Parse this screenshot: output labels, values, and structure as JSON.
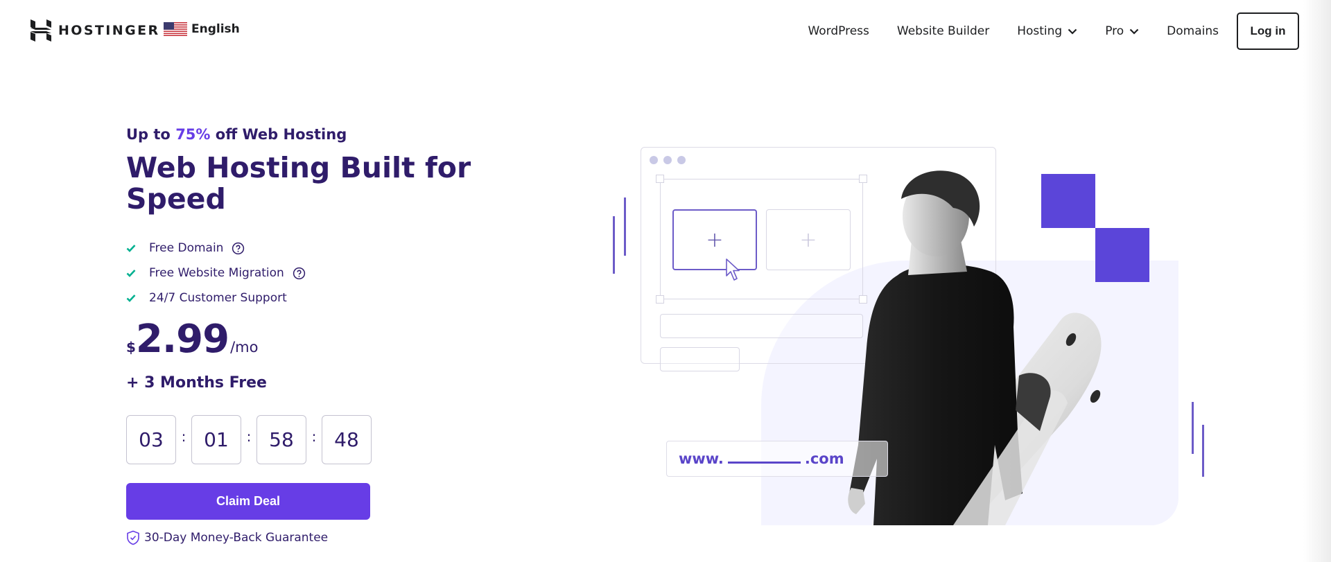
{
  "header": {
    "brand": "HOSTINGER",
    "language": "English",
    "nav": [
      {
        "label": "WordPress",
        "has_dropdown": false
      },
      {
        "label": "Website Builder",
        "has_dropdown": false
      },
      {
        "label": "Hosting",
        "has_dropdown": true
      },
      {
        "label": "Pro",
        "has_dropdown": true
      },
      {
        "label": "Domains",
        "has_dropdown": false
      }
    ],
    "login_label": "Log in"
  },
  "hero": {
    "eyebrow_prefix": "Up to ",
    "eyebrow_accent": "75%",
    "eyebrow_suffix": " off Web Hosting",
    "title": "Web Hosting Built for Speed",
    "features": [
      {
        "label": "Free Domain",
        "has_help": true
      },
      {
        "label": "Free Website Migration",
        "has_help": true
      },
      {
        "label": "24/7 Customer Support",
        "has_help": false
      }
    ],
    "price": {
      "currency": "$",
      "amount": "2.99",
      "period": "/mo"
    },
    "bonus": "+ 3 Months Free",
    "countdown": {
      "days": "03",
      "hours": "01",
      "minutes": "58",
      "seconds": "48",
      "separator": ":"
    },
    "cta_label": "Claim Deal",
    "guarantee": "30-Day Money-Back Guarantee"
  },
  "illustration": {
    "domain_prefix": "www.",
    "domain_suffix": ".com",
    "plus_glyph": "+"
  },
  "colors": {
    "brand_purple": "#673de6",
    "text_dark_purple": "#2f1c6a",
    "check_green": "#00b090",
    "panel_lavender": "#f4f4ff",
    "square_purple": "#5b45d9"
  }
}
